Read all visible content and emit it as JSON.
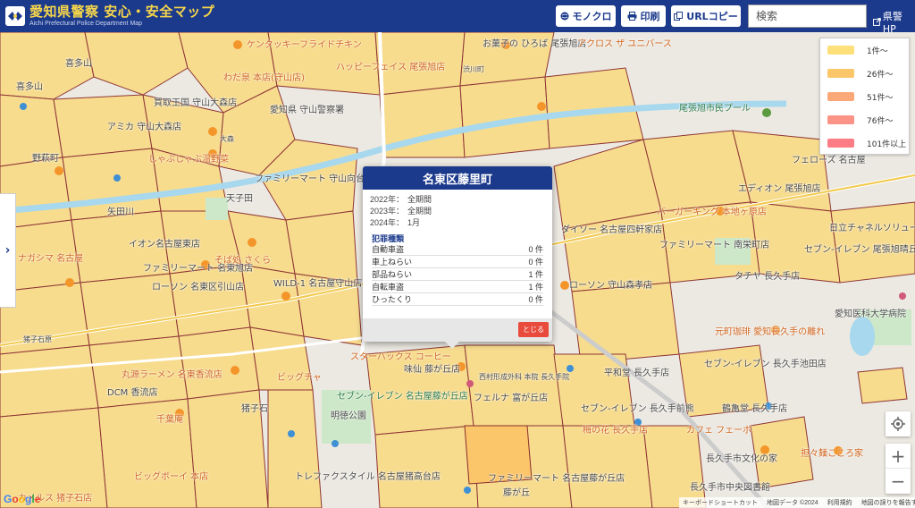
{
  "header": {
    "title": "愛知県警察 安心・安全マップ",
    "subtitle": "Aichi Prefectural Police Department Map",
    "buttons": {
      "mono": "モノクロ",
      "print": "印刷",
      "url_copy": "URLコピー"
    },
    "search_placeholder": "検索",
    "hp_link": "県警HP"
  },
  "legend": {
    "items": [
      {
        "label": "1件〜",
        "color": "#fde07a"
      },
      {
        "label": "26件〜",
        "color": "#fbc56a"
      },
      {
        "label": "51件〜",
        "color": "#fba878"
      },
      {
        "label": "76件〜",
        "color": "#fb9387"
      },
      {
        "label": "101件以上",
        "color": "#fc7d86"
      }
    ]
  },
  "popup": {
    "title": "名東区藤里町",
    "periods": [
      {
        "year": "2022年：",
        "value": "全期間"
      },
      {
        "year": "2023年：",
        "value": "全期間"
      },
      {
        "year": "2024年：",
        "value": "1月"
      }
    ],
    "section_heading": "犯罪種類",
    "crimes": [
      {
        "type": "自動車盗",
        "count": "0 件"
      },
      {
        "type": "車上ねらい",
        "count": "0 件"
      },
      {
        "type": "部品ねらい",
        "count": "1 件"
      },
      {
        "type": "自転車盗",
        "count": "1 件"
      },
      {
        "type": "ひったくり",
        "count": "0 件"
      }
    ],
    "close_label": "とじる"
  },
  "map_labels": {
    "l1": "喜多山",
    "l2": "喜多山",
    "l3": "野萩町",
    "l4": "ケンタッキーフライドチキン",
    "l5": "わだ泉 本店(守山店)",
    "l6": "買取王国 守山大森店",
    "l7": "愛知県 守山警察署",
    "l8": "アミカ 守山大森店",
    "l9": "大森",
    "l10": "しゃぶしゃぶ温野菜",
    "l11": "ファミリーマート 守山向台一丁目店",
    "l12": "天子田",
    "l13": "矢田川",
    "l14": "イオン名古屋東店",
    "l15": "ファミリーマート 名東旭店",
    "l16": "ローソン 名東区引山店",
    "l17": "そば処 さくら",
    "l18": "WILD-1 名古屋守山店",
    "l19": "ナガシマ 名古屋",
    "l20": "猪子石原",
    "l21": "猪子石",
    "l22": "明徳公園",
    "l23": "セブン-イレブン 名古屋藤が丘店",
    "l24": "スターバックス コーヒー",
    "l25": "味仙 藤が丘店",
    "l26": "フェルナ 富が丘店",
    "l27": "藤が丘",
    "l28": "ファミリーマート 名古屋藤が丘店",
    "l29": "トレファクスタイル 名古屋猪高台店",
    "l30": "丸源ラーメン 名東香流店",
    "l31": "ビッグチャ",
    "l32": "DCM 香流店",
    "l33": "千葉庵",
    "l34": "ビッグボーイ 本店",
    "l35": "カメルス 猪子石店",
    "l36": "お菓子の ひろば 尾張旭店",
    "l37": "渋川町",
    "l38": "アクロス ザ ユニバース",
    "l39": "ハッピーフェイス 尾張旭店",
    "l40": "尾張旭市民プール",
    "l41": "ダイソー 名古屋四軒家店",
    "l42": "バーガーキング 本地ヶ原店",
    "l43": "ファミリーマート 南栄町店",
    "l44": "エディオン 尾張旭店",
    "l45": "日立チャネルソリューションズ",
    "l46": "セブン-イレブン 尾張旭晴丘町",
    "l47": "タチヤ 長久手店",
    "l48": "愛知医科大学病院",
    "l49": "元町珈琲 愛知長久手の離れ",
    "l50": "セブン-イレブン 長久手池田店",
    "l51": "平和堂 長久手店",
    "l52": "セブン-イレブン 長久手前熊",
    "l53": "梅の花 長久手店",
    "l54": "カフェ フェーボ",
    "l55": "鶴亀堂 長久手店",
    "l56": "担々麺こころ家",
    "l57": "長久手市文化の家",
    "l58": "長久手市中央図書館",
    "l59": "フェローズ 名古屋",
    "l60": "ローソン 守山森孝店",
    "l61": "西村形成外科 本院 長久手院"
  },
  "attribution": {
    "shortcut": "キーボードショートカット",
    "mapdata": "地図データ ©2024",
    "terms": "利用規約",
    "report": "地図の誤りを報告する"
  }
}
